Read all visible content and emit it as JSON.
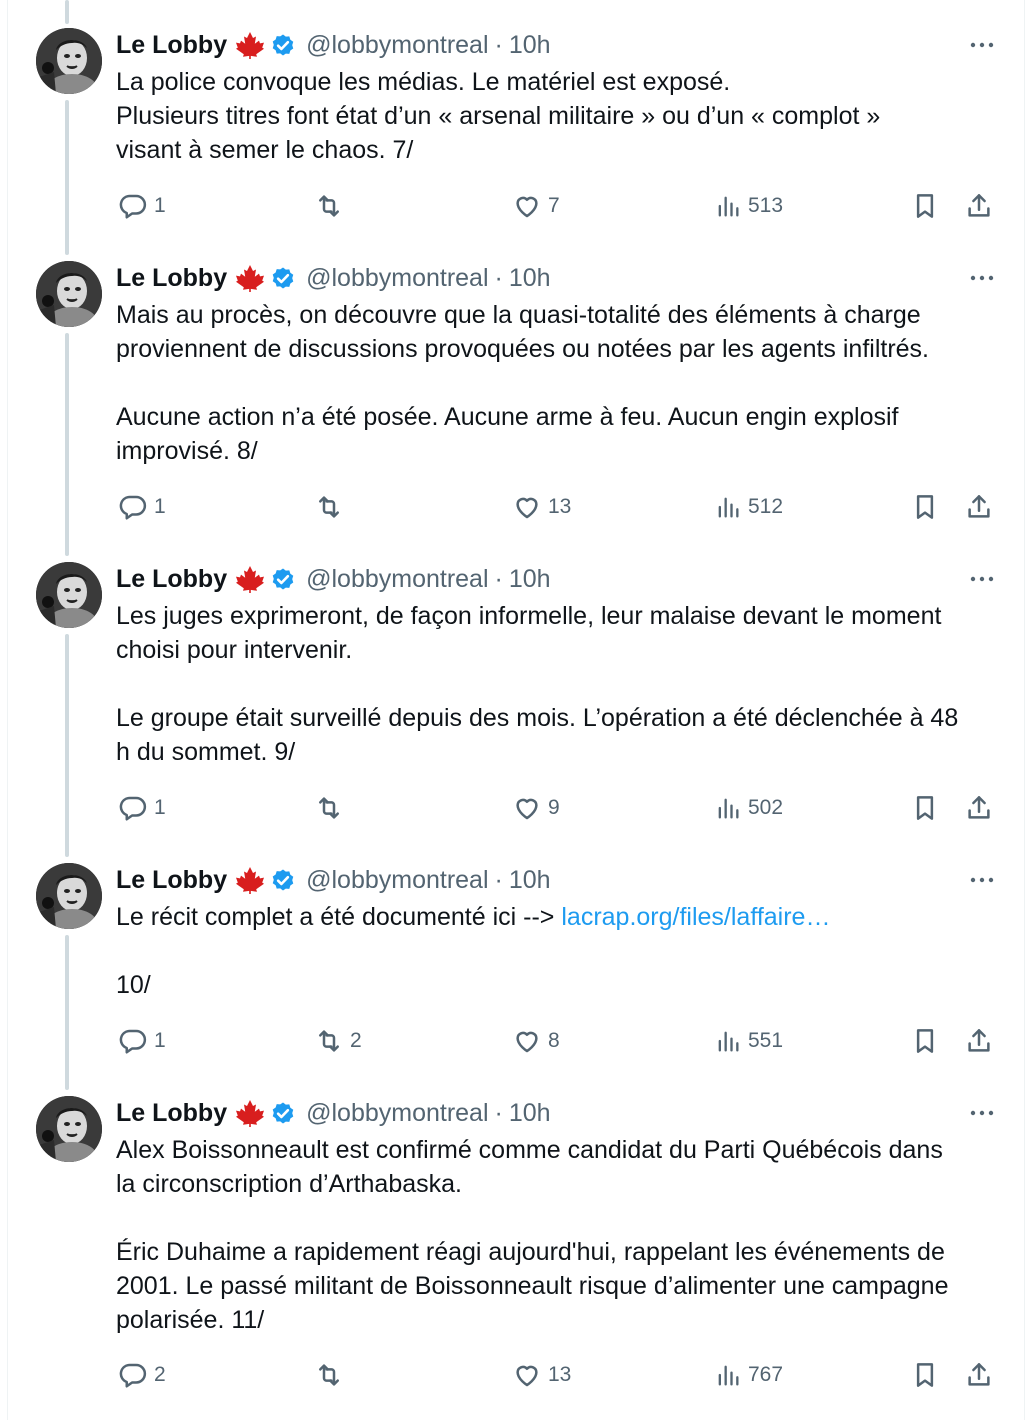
{
  "colors": {
    "accent": "#1d9bf0",
    "text": "#0f1419",
    "muted": "#536471",
    "leaf": "#d81e1e"
  },
  "author": {
    "name": "Le Lobby",
    "handle": "@lobbymontreal",
    "time": "10h",
    "separator": "·",
    "icons": [
      "maple-leaf-icon",
      "verified-badge-icon"
    ]
  },
  "tweets": [
    {
      "paragraphs": [
        [
          "La police convoque les médias. Le matériel est exposé.",
          "Plusieurs titres font état d’un « arsenal militaire » ou d’un « complot »",
          "visant à semer le chaos. 7/"
        ]
      ],
      "stats": {
        "replies": "1",
        "retweets": "",
        "likes": "7",
        "views": "513"
      }
    },
    {
      "paragraphs": [
        [
          "Mais au procès, on découvre que la quasi-totalité des éléments à charge",
          "proviennent de discussions provoquées ou notées par les agents infiltrés."
        ],
        [
          "Aucune action n’a été posée. Aucune arme à feu. Aucun engin explosif",
          "improvisé. 8/"
        ]
      ],
      "stats": {
        "replies": "1",
        "retweets": "",
        "likes": "13",
        "views": "512"
      }
    },
    {
      "paragraphs": [
        [
          "Les juges exprimeront, de façon informelle, leur malaise devant le moment",
          "choisi pour intervenir."
        ],
        [
          "Le groupe était surveillé depuis des mois. L’opération a été déclenchée à 48",
          "h du sommet. 9/"
        ]
      ],
      "stats": {
        "replies": "1",
        "retweets": "",
        "likes": "9",
        "views": "502"
      }
    },
    {
      "paragraphs": [
        [
          "Le récit complet a été documenté ici --> "
        ],
        [
          "10/"
        ]
      ],
      "link": "lacrap.org/files/laffaire…",
      "stats": {
        "replies": "1",
        "retweets": "2",
        "likes": "8",
        "views": "551"
      }
    },
    {
      "paragraphs": [
        [
          "Alex Boissonneault est confirmé comme candidat du Parti Québécois dans",
          "la circonscription d’Arthabaska."
        ],
        [
          "Éric Duhaime a rapidement réagi aujourd'hui, rappelant les événements de",
          "2001. Le passé militant de Boissonneault risque d’alimenter une campagne",
          "polarisée. 11/"
        ]
      ],
      "stats": {
        "replies": "2",
        "retweets": "",
        "likes": "13",
        "views": "767"
      }
    }
  ]
}
